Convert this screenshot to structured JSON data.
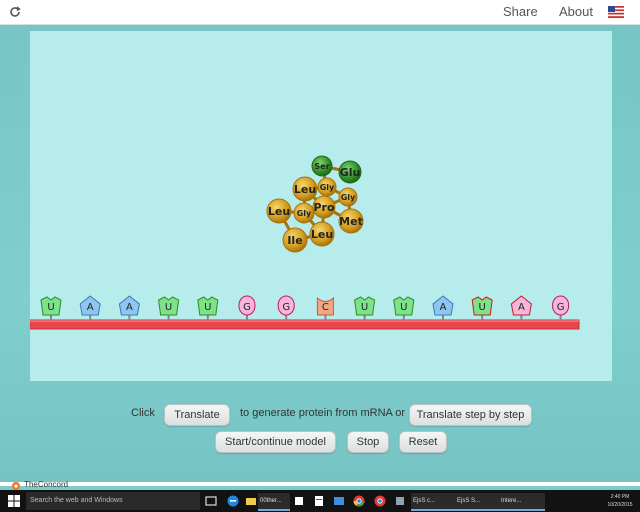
{
  "topbar": {
    "share_label": "Share",
    "about_label": "About",
    "icons": [
      "reload-icon",
      "us-flag-icon"
    ]
  },
  "protein": {
    "amino_acids": [
      {
        "label": "Ser",
        "color": "#3c9a2f"
      },
      {
        "label": "Glu",
        "color": "#3c9a2f"
      },
      {
        "label": "Gly",
        "color": "#d4a020"
      },
      {
        "label": "Gly",
        "color": "#d4a020"
      },
      {
        "label": "Leu",
        "color": "#d4a020"
      },
      {
        "label": "Pro",
        "color": "#d4a020"
      },
      {
        "label": "Gly",
        "color": "#d4a020"
      },
      {
        "label": "Leu",
        "color": "#d4a020"
      },
      {
        "label": "Met",
        "color": "#d4a020"
      },
      {
        "label": "Leu",
        "color": "#d4a020"
      },
      {
        "label": "Ile",
        "color": "#d4a020"
      }
    ]
  },
  "mrna": {
    "strand_color": "#e8464d",
    "nucleotides": [
      {
        "base": "U",
        "color": "#7de28a"
      },
      {
        "base": "A",
        "color": "#8fc6ef"
      },
      {
        "base": "A",
        "color": "#8fc6ef"
      },
      {
        "base": "U",
        "color": "#7de28a"
      },
      {
        "base": "U",
        "color": "#7de28a"
      },
      {
        "base": "G",
        "color": "#f6b6dc"
      },
      {
        "base": "G",
        "color": "#f6b6dc"
      },
      {
        "base": "C",
        "color": "#f4a583"
      },
      {
        "base": "U",
        "color": "#7de28a"
      },
      {
        "base": "U",
        "color": "#7de28a"
      },
      {
        "base": "A",
        "color": "#8fc6ef"
      },
      {
        "base": "U",
        "color": "#7de28a"
      },
      {
        "base": "A",
        "color": "#f6b6dc"
      },
      {
        "base": "G",
        "color": "#f6b6dc"
      }
    ]
  },
  "controls": {
    "click_text": "Click",
    "translate_label": "Translate",
    "middle_text": "to generate protein from mRNA or",
    "step_label": "Translate step by step",
    "start_label": "Start/continue model",
    "stop_label": "Stop",
    "reset_label": "Reset"
  },
  "footer": {
    "logo_text": "TheConcord"
  },
  "taskbar": {
    "search_placeholder": "Search the web and Windows",
    "apps": [
      "00ther...",
      "EjsS c...",
      "EjsS S...",
      "Intere..."
    ],
    "time": "2:40 PM",
    "date": "10/20/2015"
  }
}
